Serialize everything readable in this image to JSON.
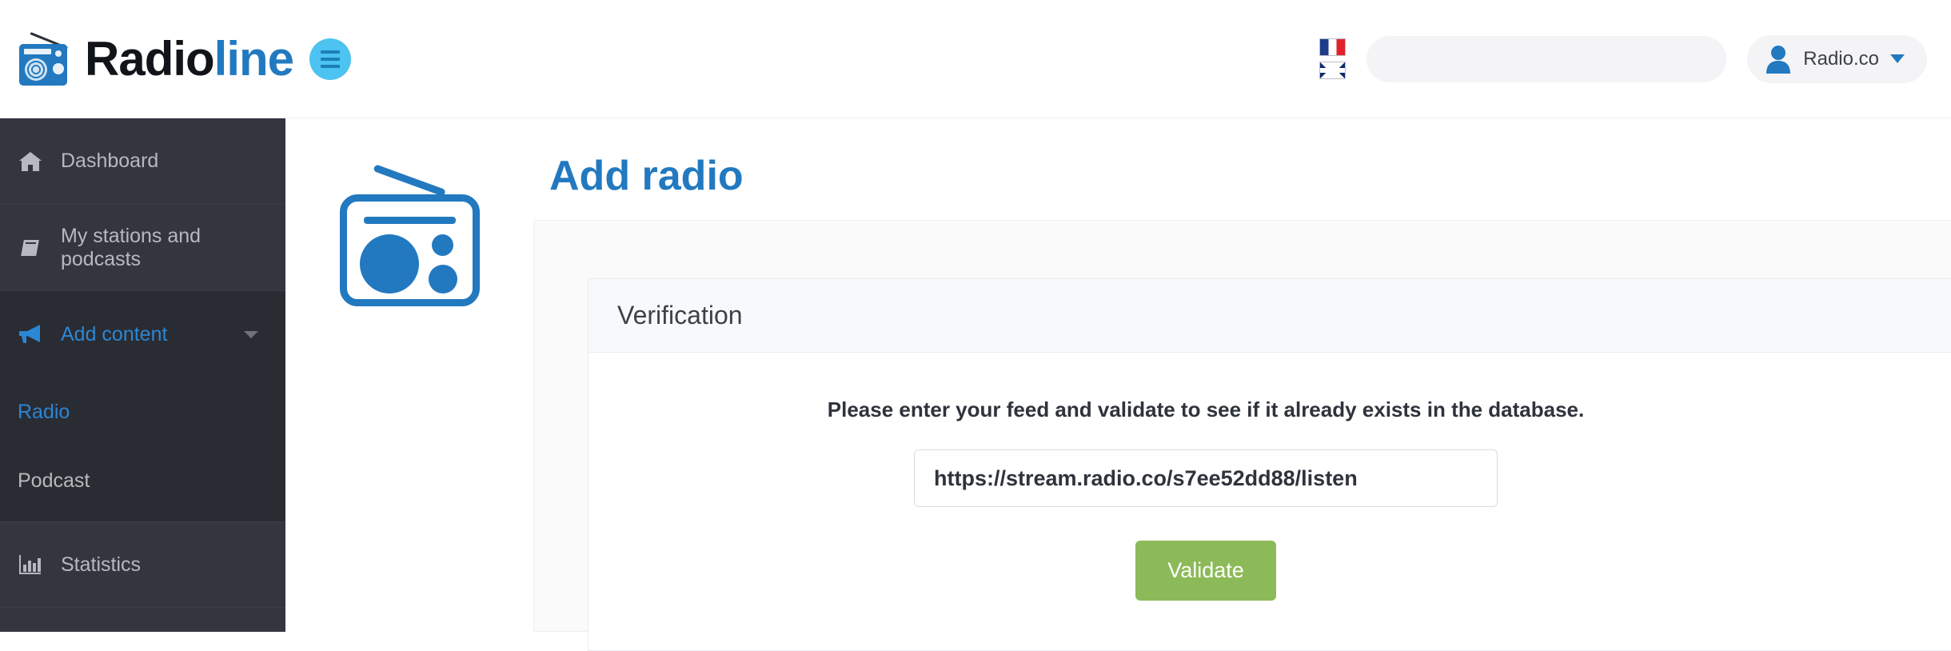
{
  "header": {
    "brand_black": "Radio",
    "brand_blue": "line",
    "menu_icon": "hamburger-icon",
    "logo_icon": "radio-logo-icon",
    "flags": [
      {
        "name": "flag-fr",
        "label": "Français"
      },
      {
        "name": "flag-gb",
        "label": "English"
      }
    ],
    "search": {
      "value": "",
      "placeholder": ""
    },
    "user": {
      "name": "Radio.co",
      "avatar_icon": "user-avatar-icon",
      "caret_icon": "chevron-down-icon"
    }
  },
  "sidebar": {
    "items": [
      {
        "label": "Dashboard",
        "icon": "home-icon",
        "active": false
      },
      {
        "label": "My stations and podcasts",
        "icon": "book-icon",
        "active": false
      },
      {
        "label": "Add content",
        "icon": "megaphone-icon",
        "active": true,
        "chevron": "chevron-down-icon"
      },
      {
        "label": "Statistics",
        "icon": "bar-chart-icon",
        "active": false
      }
    ],
    "submenu": [
      {
        "label": "Radio",
        "active": true
      },
      {
        "label": "Podcast",
        "active": false
      }
    ]
  },
  "main": {
    "illustration_icon": "radio-illustration-icon",
    "title": "Add radio",
    "card": {
      "header": "Verification",
      "instruction": "Please enter your feed and validate to see if it already exists in the database.",
      "input": {
        "value": "https://stream.radio.co/s7ee52dd88/listen",
        "placeholder": ""
      },
      "validate_label": "Validate"
    }
  },
  "colors": {
    "brand_blue": "#2279c0",
    "accent_cyan": "#4cc3f0",
    "sidebar_bg": "#33363f",
    "sidebar_active_bg": "#2a2c33",
    "validate_green": "#8cba58",
    "text_dark": "#2f333b"
  }
}
